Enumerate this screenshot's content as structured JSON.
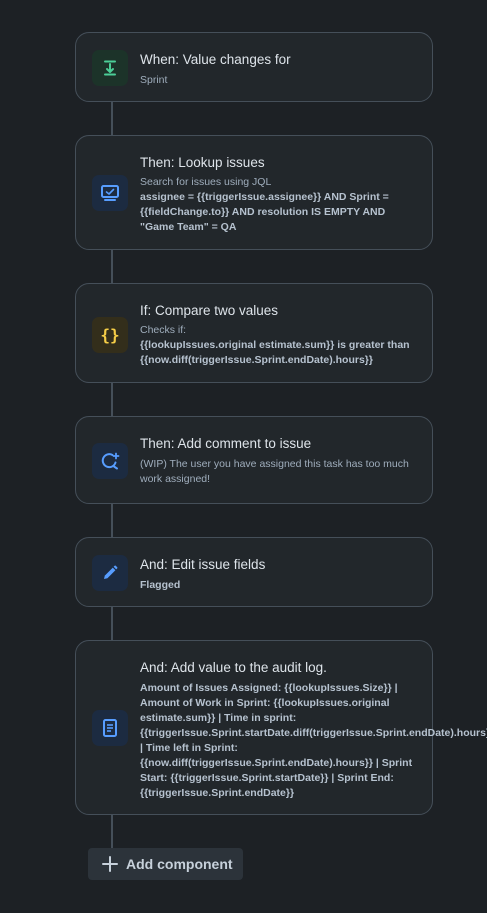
{
  "components": [
    {
      "title": "When: Value changes for",
      "lines": [
        {
          "text": "Sprint",
          "style": "sub"
        }
      ],
      "icon": "download-arrow-icon"
    },
    {
      "title": "Then: Lookup issues",
      "lines": [
        {
          "text": "Search for issues using JQL",
          "style": "sub"
        },
        {
          "text": "assignee = {{triggerIssue.assignee}} AND Sprint = {{fieldChange.to}} AND resolution IS EMPTY AND \"Game Team\" = QA",
          "style": "bold"
        }
      ],
      "icon": "monitor-icon"
    },
    {
      "title": "If: Compare two values",
      "lines": [
        {
          "text": "Checks if:",
          "style": "sub"
        },
        {
          "text": "{{lookupIssues.original estimate.sum}} is greater than {{now.diff(triggerIssue.Sprint.endDate).hours}}",
          "style": "bold"
        }
      ],
      "icon": "braces-icon"
    },
    {
      "title": "Then: Add comment to issue",
      "lines": [
        {
          "text": "(WIP) The user you have assigned this task has too much work assigned!",
          "style": "sub"
        }
      ],
      "icon": "comment-add-icon"
    },
    {
      "title": "And: Edit issue fields",
      "lines": [
        {
          "text": "Flagged",
          "style": "bold"
        }
      ],
      "icon": "pencil-icon"
    },
    {
      "title": "And: Add value to the audit log.",
      "lines": [
        {
          "text": "Amount of Issues Assigned: {{lookupIssues.Size}} | Amount of Work in Sprint: {{lookupIssues.original estimate.sum}} | Time in sprint: {{triggerIssue.Sprint.startDate.diff(triggerIssue.Sprint.endDate).hours}} | Time left in Sprint: {{now.diff(triggerIssue.Sprint.endDate).hours}} | Sprint Start: {{triggerIssue.Sprint.startDate}} | Sprint End: {{triggerIssue.Sprint.endDate}}",
          "style": "bold"
        }
      ],
      "icon": "document-icon"
    }
  ],
  "add_component_label": "Add component",
  "colors": {
    "accent_green": "#4bce97",
    "accent_blue": "#579dff",
    "accent_yellow": "#f5cd47"
  }
}
